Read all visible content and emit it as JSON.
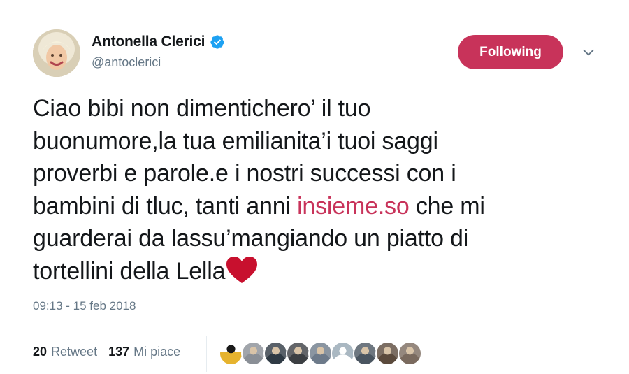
{
  "author": {
    "display_name": "Antonella Clerici",
    "handle": "@antoclerici",
    "verified": true,
    "avatar_icon": "profile-photo"
  },
  "follow_button": {
    "label": "Following",
    "color": "#c8335a"
  },
  "menu_icon": "chevron-down-icon",
  "tweet": {
    "lines": [
      "Ciao bibi non dimentichero’ il tuo",
      "buonumore,la tua emilianita’i tuoi saggi",
      "proverbi e parole.e i nostri successi con i",
      {
        "before": "bambini di tluc, tanti anni ",
        "link": "insieme.so",
        "after": " che mi"
      },
      "guarderai da lassu’mangiando un piatto di",
      {
        "before": "tortellini della Lella",
        "emoji": "red-heart"
      }
    ],
    "link_color": "#c8335a"
  },
  "timestamp": "09:13 - 15 feb 2018",
  "stats": {
    "retweets": {
      "count": "20",
      "label": "Retweet"
    },
    "likes": {
      "count": "137",
      "label": "Mi piace"
    }
  },
  "likers": [
    {
      "icon": "liker-avatar-1",
      "color": "#e6b32e"
    },
    {
      "icon": "liker-avatar-2",
      "color": "#8a8f96"
    },
    {
      "icon": "liker-avatar-3",
      "color": "#2f3a44"
    },
    {
      "icon": "liker-avatar-4",
      "color": "#3c3f43"
    },
    {
      "icon": "liker-avatar-5",
      "color": "#6d7a8a"
    },
    {
      "icon": "liker-avatar-6",
      "color": "#aab8c2"
    },
    {
      "icon": "liker-avatar-7",
      "color": "#4a5560"
    },
    {
      "icon": "liker-avatar-8",
      "color": "#5b4a3c"
    },
    {
      "icon": "liker-avatar-9",
      "color": "#7a6a5e"
    }
  ]
}
